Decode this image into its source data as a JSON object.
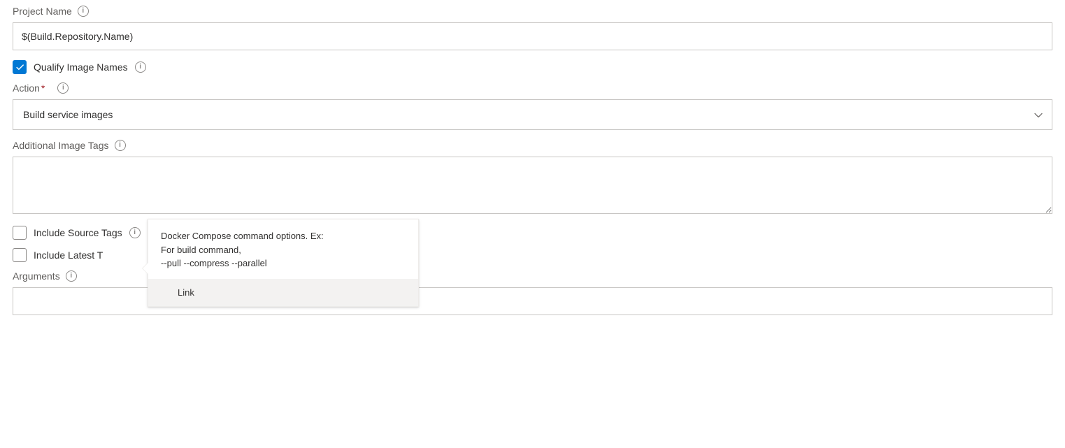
{
  "projectName": {
    "label": "Project Name",
    "value": "$(Build.Repository.Name)"
  },
  "qualifyImageNames": {
    "label": "Qualify Image Names",
    "checked": true
  },
  "action": {
    "label": "Action",
    "required": "*",
    "value": "Build service images"
  },
  "additionalImageTags": {
    "label": "Additional Image Tags",
    "value": ""
  },
  "includeSourceTags": {
    "label": "Include Source Tags",
    "checked": false
  },
  "includeLatestTag": {
    "label": "Include Latest T",
    "checked": false
  },
  "arguments": {
    "label": "Arguments",
    "value": "",
    "tooltip": {
      "line1": "Docker Compose command options. Ex:",
      "line2": "For build command,",
      "line3": "--pull --compress --parallel",
      "link": "Link"
    }
  }
}
